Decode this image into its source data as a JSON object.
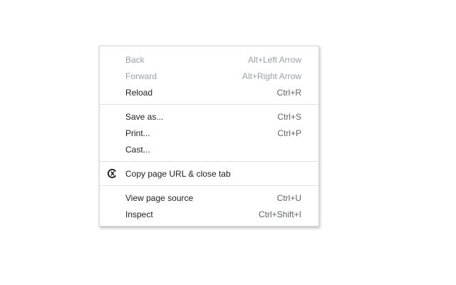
{
  "context_menu": {
    "groups": [
      {
        "items": [
          {
            "label": "Back",
            "shortcut": "Alt+Left Arrow"
          },
          {
            "label": "Forward",
            "shortcut": "Alt+Right Arrow"
          },
          {
            "label": "Reload",
            "shortcut": "Ctrl+R"
          }
        ]
      },
      {
        "items": [
          {
            "label": "Save as...",
            "shortcut": "Ctrl+S"
          },
          {
            "label": "Print...",
            "shortcut": "Ctrl+P"
          },
          {
            "label": "Cast...",
            "shortcut": ""
          }
        ]
      },
      {
        "items": [
          {
            "label": "Copy page URL & close tab",
            "icon": "extension-logo-icon"
          }
        ]
      },
      {
        "items": [
          {
            "label": "View page source",
            "shortcut": "Ctrl+U"
          },
          {
            "label": "Inspect",
            "shortcut": "Ctrl+Shift+I"
          }
        ]
      }
    ]
  },
  "colors": {
    "text": "#202124",
    "disabled_text": "#9aa0a6",
    "separator": "#e3e3e3",
    "menu_background": "#ffffff"
  }
}
